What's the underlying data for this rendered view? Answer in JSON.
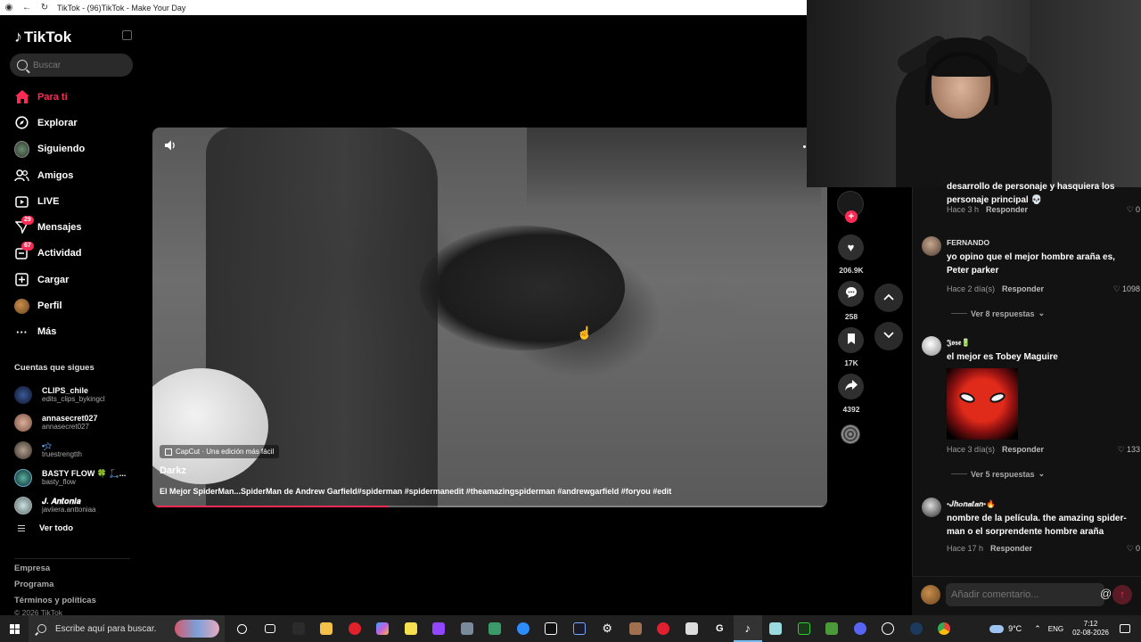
{
  "browser": {
    "title": "TikTok - (96)TikTok - Make Your Day"
  },
  "sidebar": {
    "logo": "TikTok",
    "search_placeholder": "Buscar",
    "nav": [
      {
        "label": "Para ti",
        "icon": "home-icon",
        "active": true
      },
      {
        "label": "Explorar",
        "icon": "compass-icon"
      },
      {
        "label": "Siguiendo",
        "icon": "following-avatar-icon"
      },
      {
        "label": "Amigos",
        "icon": "friends-icon"
      },
      {
        "label": "LIVE",
        "icon": "live-icon"
      },
      {
        "label": "Mensajes",
        "icon": "messages-icon",
        "badge": "29"
      },
      {
        "label": "Actividad",
        "icon": "activity-icon",
        "badge": "67"
      },
      {
        "label": "Cargar",
        "icon": "upload-icon"
      },
      {
        "label": "Perfil",
        "icon": "profile-avatar-icon"
      },
      {
        "label": "Más",
        "icon": "more-icon"
      }
    ],
    "following_title": "Cuentas que sigues",
    "following": [
      {
        "name": "CLIPS_chile",
        "sub": "edits_clips_bykingcl",
        "color": "#1c2a4a"
      },
      {
        "name": "annasecret027",
        "sub": "annasecret027",
        "color": "#b89080"
      },
      {
        "name": "•̩͙✩",
        "sub": "truestrengtth",
        "color": "#7a6a5a"
      },
      {
        "name": "BASTY FLOW 🍀 🛴...",
        "sub": "basty_flow",
        "color": "#2a6a5a"
      },
      {
        "name": "𝑱. 𝑨𝒏𝒕𝒐𝒏𝒊𝒂",
        "sub": "javiiera.anttoniaa",
        "color": "#8aa0a0"
      }
    ],
    "see_all": "Ver todo",
    "footer": [
      "Empresa",
      "Programa",
      "Términos y políticas"
    ],
    "copyright": "© 2026 TikTok"
  },
  "video": {
    "capcut": "CapCut · Una edición más fácil",
    "author": "Darkz",
    "description": "El Mejor SpiderMan...SpiderMan de Andrew Garfield#spiderman #spidermanedit #theamazingspiderman #andrewgarfield #foryou #edit",
    "progress": 0.35,
    "likes": "206.9K",
    "comments": "258",
    "saves": "17K",
    "shares": "4392"
  },
  "comments": [
    {
      "name": "",
      "text": "desarrollo de personaje y hasquiera los personaje principal 💀",
      "time": "Hace 3 h",
      "reply": "Responder",
      "likes": "0"
    },
    {
      "name": "FERNANDO",
      "text": "yo opino que el mejor hombre araña es, Peter parker",
      "time": "Hace 2 día(s)",
      "reply": "Responder",
      "likes": "1098",
      "replies": "Ver 8 respuestas"
    },
    {
      "name": "𝕵𝖔𝖘𝖊🔋",
      "text": "el mejor es Tobey Maguire",
      "time": "Hace 3 día(s)",
      "reply": "Responder",
      "likes": "133",
      "replies": "Ver 5 respuestas"
    },
    {
      "name": "•𝑱𝒉𝒐𝒏𝒂𝒕𝒂𝒏•🔥",
      "text": "nombre de la película. the amazing spider-man o el sorprendente hombre araña",
      "time": "Hace 17 h",
      "reply": "Responder",
      "likes": "0"
    }
  ],
  "comment_input_placeholder": "Añadir comentario...",
  "taskbar": {
    "search": "Escribe aquí para buscar.",
    "weather": "9°C",
    "lang": "ENG",
    "time": "7:12",
    "date": "02-08-2026"
  }
}
